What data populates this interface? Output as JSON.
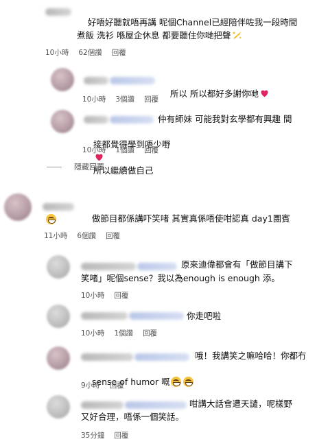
{
  "comments": [
    {
      "text": "好唔好聽就唔再講 呢個Channel已經陪伴咗我一段時間 煮飯 洗衫 喺屋企休息 都要聽住你哋把聲",
      "time": "10小時",
      "likes": "62個讚",
      "reply": "回覆"
    },
    {
      "text": "所以 所以都好多謝你哋",
      "time": "10小時",
      "likes": "3個讚",
      "reply": "回覆"
    },
    {
      "text_line1": "仲有師妹 可能我對玄學都有興趣 間",
      "text_line2": "接都覺得學到唔少嘢",
      "text_line2b": "所以繼續做自己",
      "time": "10小時",
      "likes": "1個讚",
      "reply": "回覆"
    },
    {
      "hide_label": "隱藏回覆"
    },
    {
      "text": "做節目都係講吓笑啫 其實真係唔使咁認真 day1團賓",
      "time": "11小時",
      "likes": "6個讚",
      "reply": "回覆"
    },
    {
      "text_line1": "原來迪偉都會有「做節目講下",
      "text_line2": "笑啫」呢個sense？我以為enough is enough 添。",
      "time": "10小時",
      "reply": "回覆"
    },
    {
      "text": "你走吧啦",
      "time": "10小時",
      "likes": "1個讚",
      "reply": "回覆"
    },
    {
      "text_line1": "哦！我講笑之嘛哈哈！你都冇",
      "text_line2": "sense of humor 嘅",
      "time": "9小時",
      "reply": "回覆"
    },
    {
      "text_line1": "咁講大話會遭天譴，呢樣野",
      "text_line2": "又好合理，唔係一個笑話。",
      "time": "35分鐘",
      "reply": "回覆"
    }
  ],
  "colors": {
    "heart": "#e0245e",
    "meta": "#555555",
    "mention": "#b9c7e8"
  },
  "icons": [
    "heart-emoji-icon",
    "sparkle-emoji-icon",
    "grin-emoji-icon"
  ]
}
